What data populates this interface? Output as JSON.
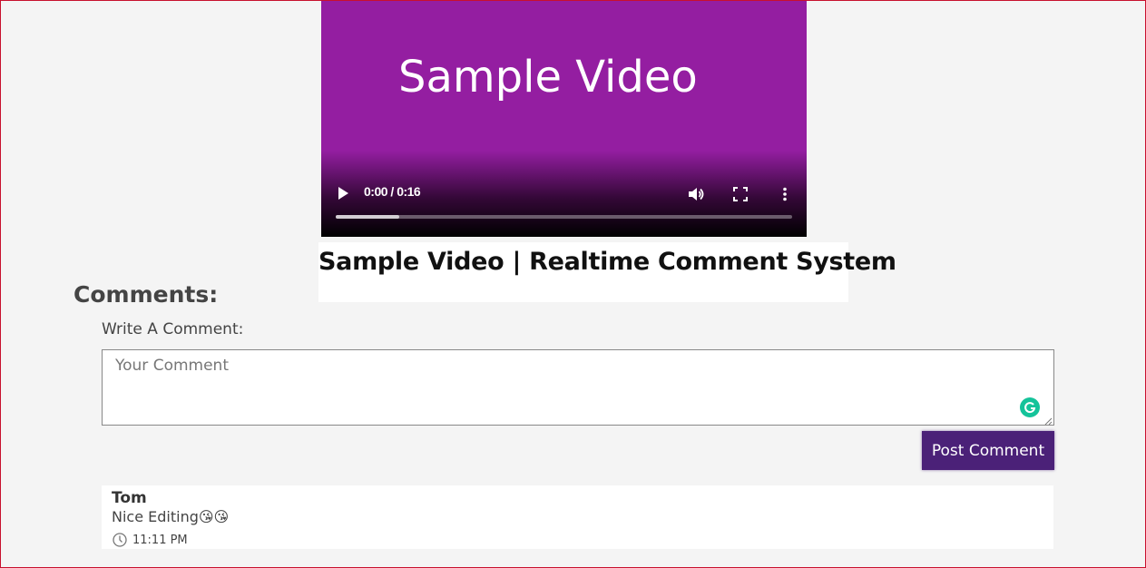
{
  "video": {
    "poster_title": "Sample Video",
    "time_display": "0:00 / 0:16",
    "progress_fraction": 0.14
  },
  "page": {
    "heading": "Sample Video | Realtime Comment System",
    "comments_title": "Comments:"
  },
  "form": {
    "label": "Write A Comment:",
    "placeholder": "Your Comment",
    "submit_label": "Post Comment"
  },
  "comments": [
    {
      "author": "Tom",
      "text": "Nice Editing😘😘",
      "time": "11:11 PM"
    }
  ],
  "colors": {
    "video_bg": "#941ea1",
    "button_bg": "#4b2178",
    "page_bg": "#f4f4f4",
    "grammarly": "#15c39a"
  }
}
